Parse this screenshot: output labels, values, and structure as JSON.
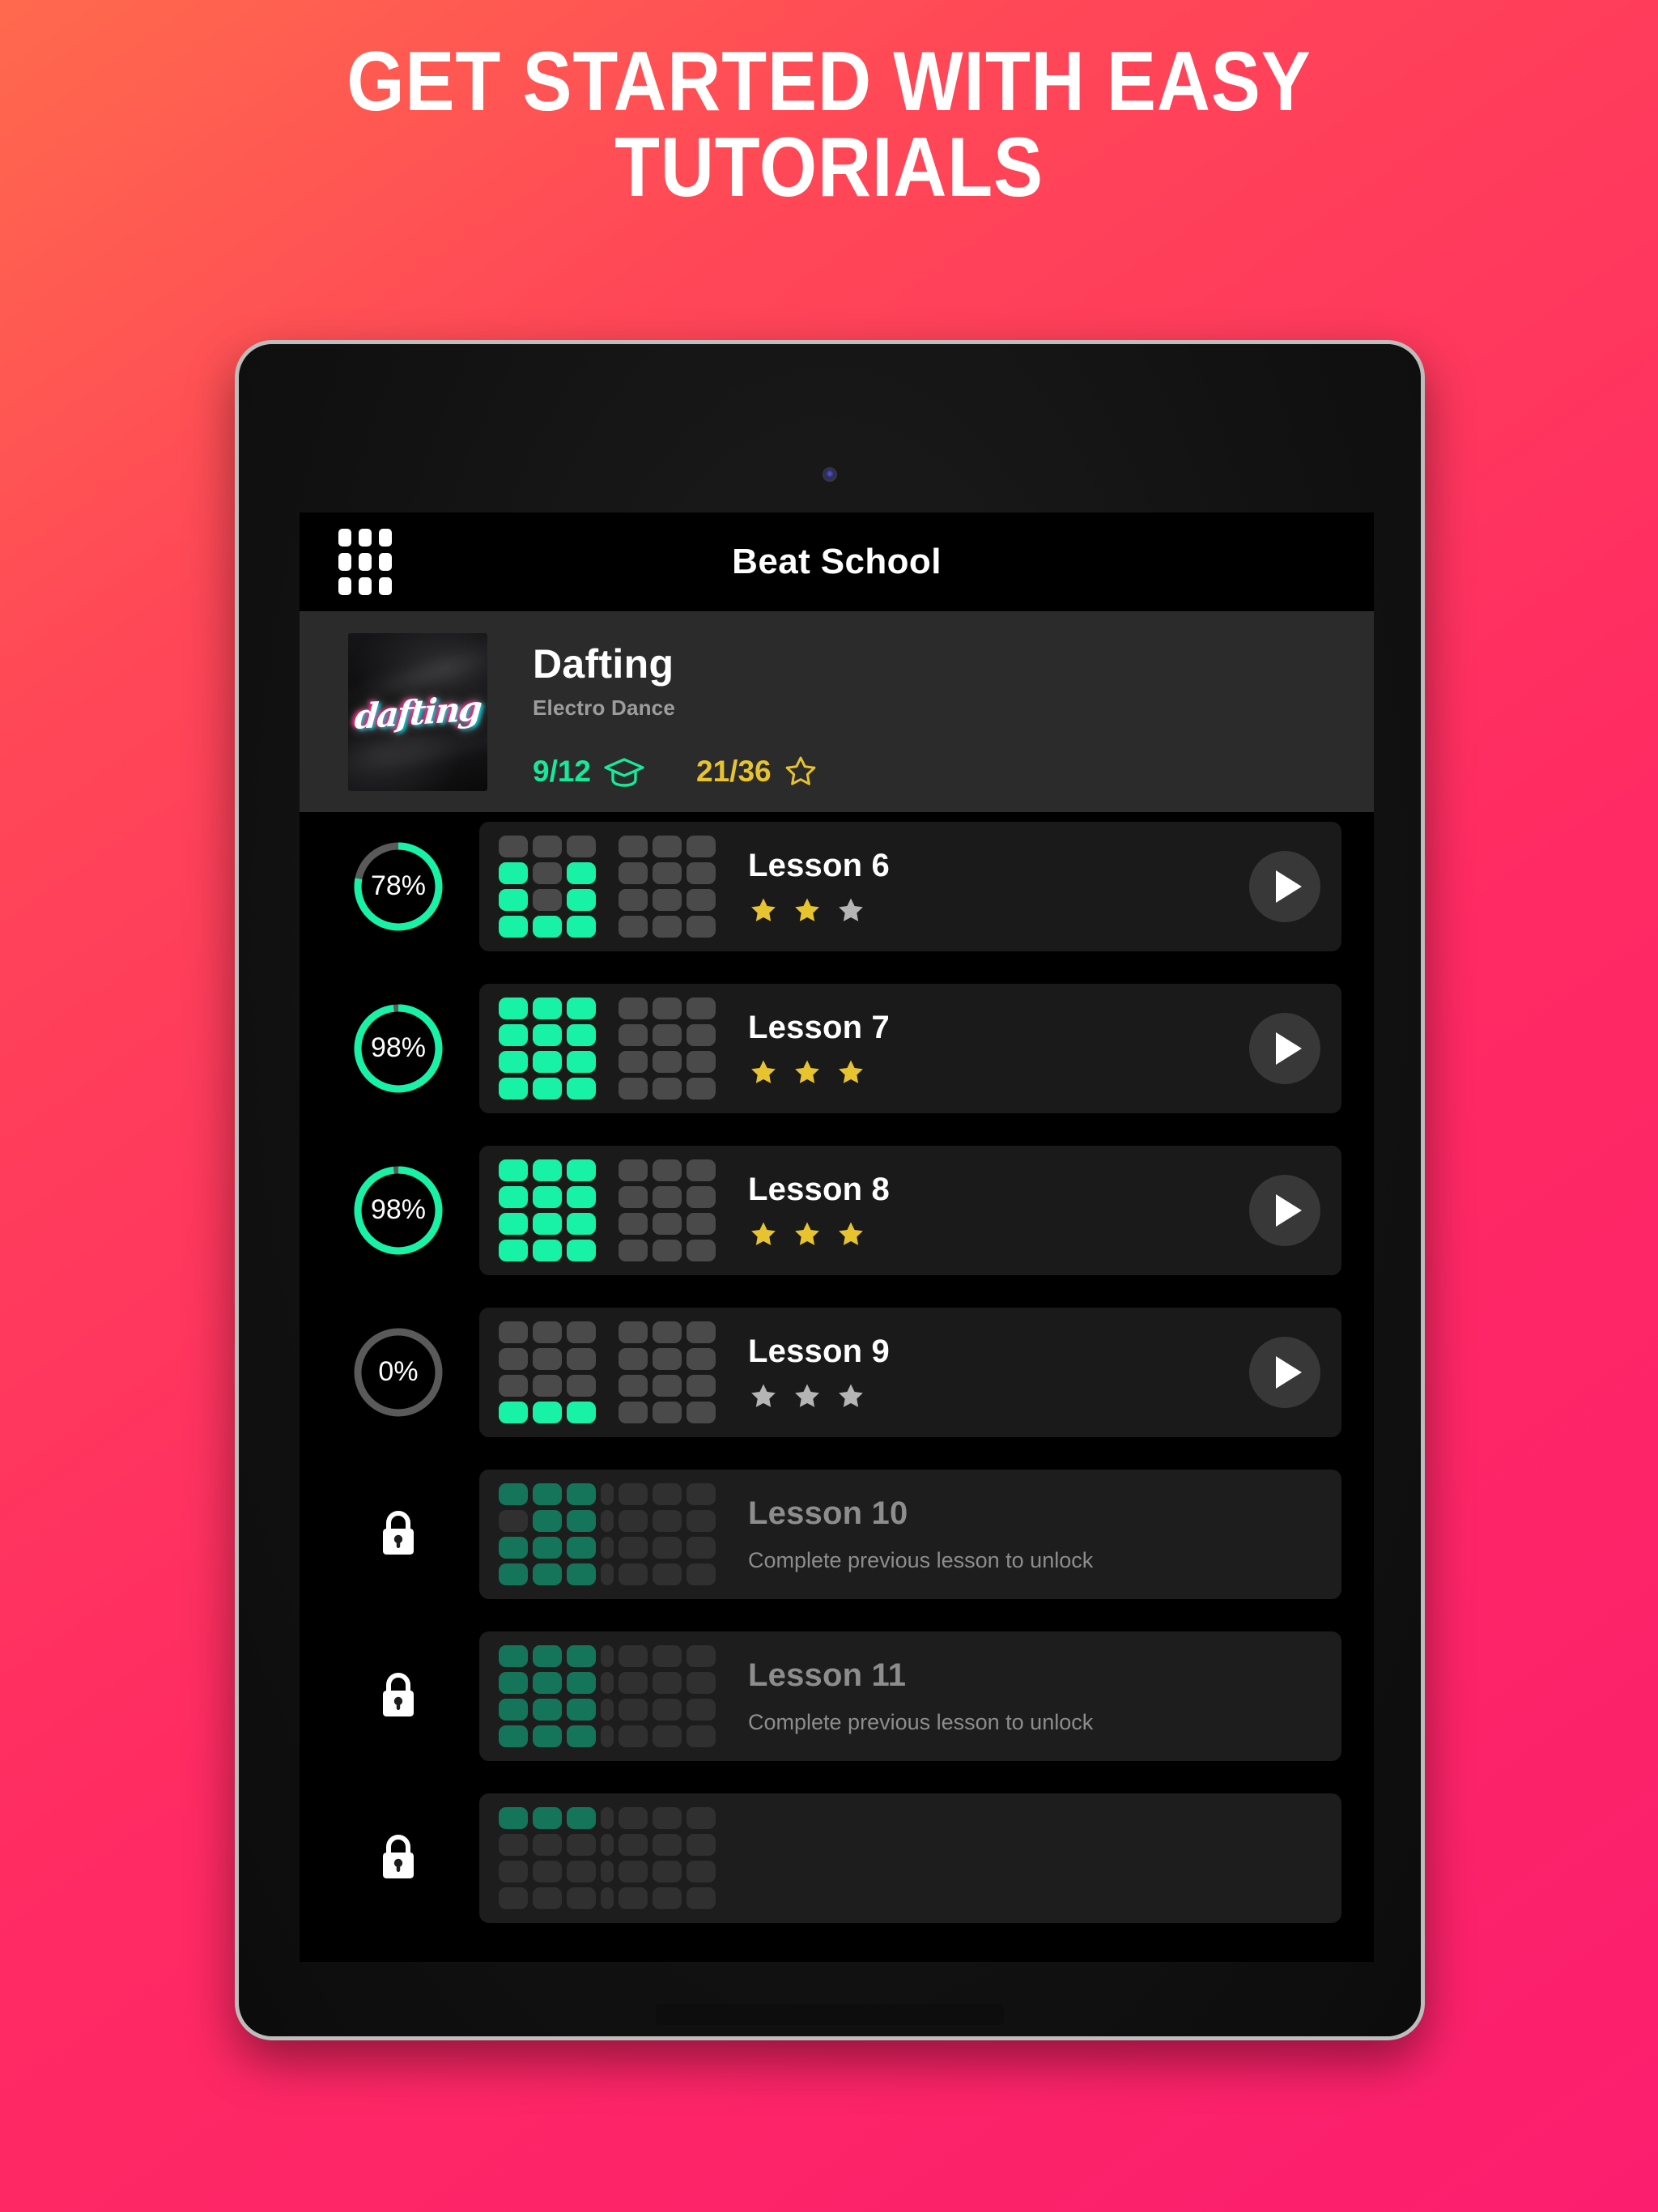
{
  "promo": {
    "headline_line1": "GET STARTED WITH EASY",
    "headline_line2": "TUTORIALS",
    "background_color": "#FF2A63"
  },
  "app": {
    "title": "Beat School",
    "menu_icon": "grid-icon",
    "accent_green": "#18F2A6",
    "accent_yellow": "#E8C330"
  },
  "course": {
    "title": "Dafting",
    "genre": "Electro Dance",
    "cover_word": "dafting",
    "lessons_progress": "9/12",
    "lessons_icon": "graduation-cap-icon",
    "stars_progress": "21/36",
    "stars_icon": "star-outline-icon"
  },
  "lessons": [
    {
      "name": "Lesson 6",
      "percent": "78%",
      "percent_value": 78,
      "locked": false,
      "stars_filled": 2,
      "stars_total": 3,
      "play_label": "play-icon",
      "note": "",
      "pads": [
        [
          0,
          0,
          0,
          0,
          0,
          0
        ],
        [
          1,
          0,
          1,
          0,
          0,
          0
        ],
        [
          1,
          0,
          1,
          0,
          0,
          0
        ],
        [
          1,
          1,
          1,
          0,
          0,
          0
        ]
      ]
    },
    {
      "name": "Lesson 7",
      "percent": "98%",
      "percent_value": 98,
      "locked": false,
      "stars_filled": 3,
      "stars_total": 3,
      "play_label": "play-icon",
      "note": "",
      "pads": [
        [
          1,
          1,
          1,
          0,
          0,
          0
        ],
        [
          1,
          1,
          1,
          0,
          0,
          0
        ],
        [
          1,
          1,
          1,
          0,
          0,
          0
        ],
        [
          1,
          1,
          1,
          0,
          0,
          0
        ]
      ]
    },
    {
      "name": "Lesson 8",
      "percent": "98%",
      "percent_value": 98,
      "locked": false,
      "stars_filled": 3,
      "stars_total": 3,
      "play_label": "play-icon",
      "note": "",
      "pads": [
        [
          1,
          1,
          1,
          0,
          0,
          0
        ],
        [
          1,
          1,
          1,
          0,
          0,
          0
        ],
        [
          1,
          1,
          1,
          0,
          0,
          0
        ],
        [
          1,
          1,
          1,
          0,
          0,
          0
        ]
      ]
    },
    {
      "name": "Lesson 9",
      "percent": "0%",
      "percent_value": 0,
      "locked": false,
      "stars_filled": 0,
      "stars_total": 3,
      "play_label": "play-icon",
      "note": "",
      "pads": [
        [
          0,
          0,
          0,
          0,
          0,
          0
        ],
        [
          0,
          0,
          0,
          0,
          0,
          0
        ],
        [
          0,
          0,
          0,
          0,
          0,
          0
        ],
        [
          1,
          1,
          1,
          0,
          0,
          0
        ]
      ]
    },
    {
      "name": "Lesson 10",
      "percent": "",
      "percent_value": null,
      "locked": true,
      "stars_filled": 0,
      "stars_total": 0,
      "play_label": "",
      "note": "Complete previous lesson to unlock",
      "pads": [
        [
          1,
          1,
          1,
          0,
          0,
          0
        ],
        [
          0,
          1,
          1,
          0,
          0,
          0
        ],
        [
          1,
          1,
          1,
          0,
          0,
          0
        ],
        [
          1,
          1,
          1,
          0,
          0,
          0
        ]
      ]
    },
    {
      "name": "Lesson 11",
      "percent": "",
      "percent_value": null,
      "locked": true,
      "stars_filled": 0,
      "stars_total": 0,
      "play_label": "",
      "note": "Complete previous lesson to unlock",
      "pads": [
        [
          1,
          1,
          1,
          0,
          0,
          0
        ],
        [
          1,
          1,
          1,
          0,
          0,
          0
        ],
        [
          1,
          1,
          1,
          0,
          0,
          0
        ],
        [
          1,
          1,
          1,
          0,
          0,
          0
        ]
      ]
    },
    {
      "name": "",
      "percent": "",
      "percent_value": null,
      "locked": true,
      "stars_filled": 0,
      "stars_total": 0,
      "play_label": "",
      "note": "",
      "pads": [
        [
          1,
          1,
          1,
          0,
          0,
          0
        ],
        [
          0,
          0,
          0,
          0,
          0,
          0
        ],
        [
          0,
          0,
          0,
          0,
          0,
          0
        ],
        [
          0,
          0,
          0,
          0,
          0,
          0
        ]
      ]
    }
  ]
}
